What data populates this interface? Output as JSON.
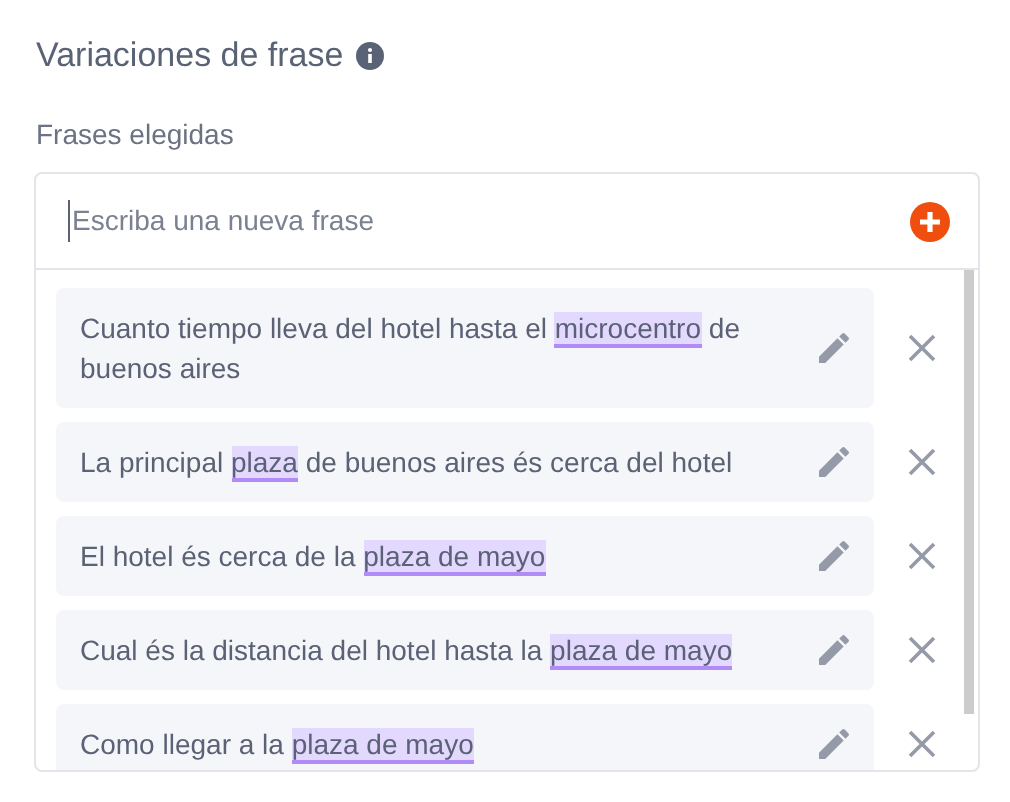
{
  "title": "Variaciones de frase",
  "field_label": "Frases elegidas",
  "new_phrase": {
    "placeholder": "Escriba una nueva frase"
  },
  "phrases": [
    {
      "segments": [
        {
          "text": "Cuanto tiempo lleva del hotel hasta el ",
          "highlighted": false
        },
        {
          "text": "microcentro",
          "highlighted": true
        },
        {
          "text": " de buenos aires",
          "highlighted": false
        }
      ]
    },
    {
      "segments": [
        {
          "text": "La principal ",
          "highlighted": false
        },
        {
          "text": "plaza",
          "highlighted": true
        },
        {
          "text": " de buenos aires és cerca del hotel",
          "highlighted": false
        }
      ]
    },
    {
      "segments": [
        {
          "text": "El hotel és cerca de la ",
          "highlighted": false
        },
        {
          "text": "plaza de mayo",
          "highlighted": true
        }
      ]
    },
    {
      "segments": [
        {
          "text": "Cual és la distancia del hotel hasta la ",
          "highlighted": false
        },
        {
          "text": "plaza de mayo",
          "highlighted": true
        }
      ]
    },
    {
      "segments": [
        {
          "text": "Como llegar a la ",
          "highlighted": false
        },
        {
          "text": "plaza de mayo",
          "highlighted": true
        }
      ]
    }
  ]
}
